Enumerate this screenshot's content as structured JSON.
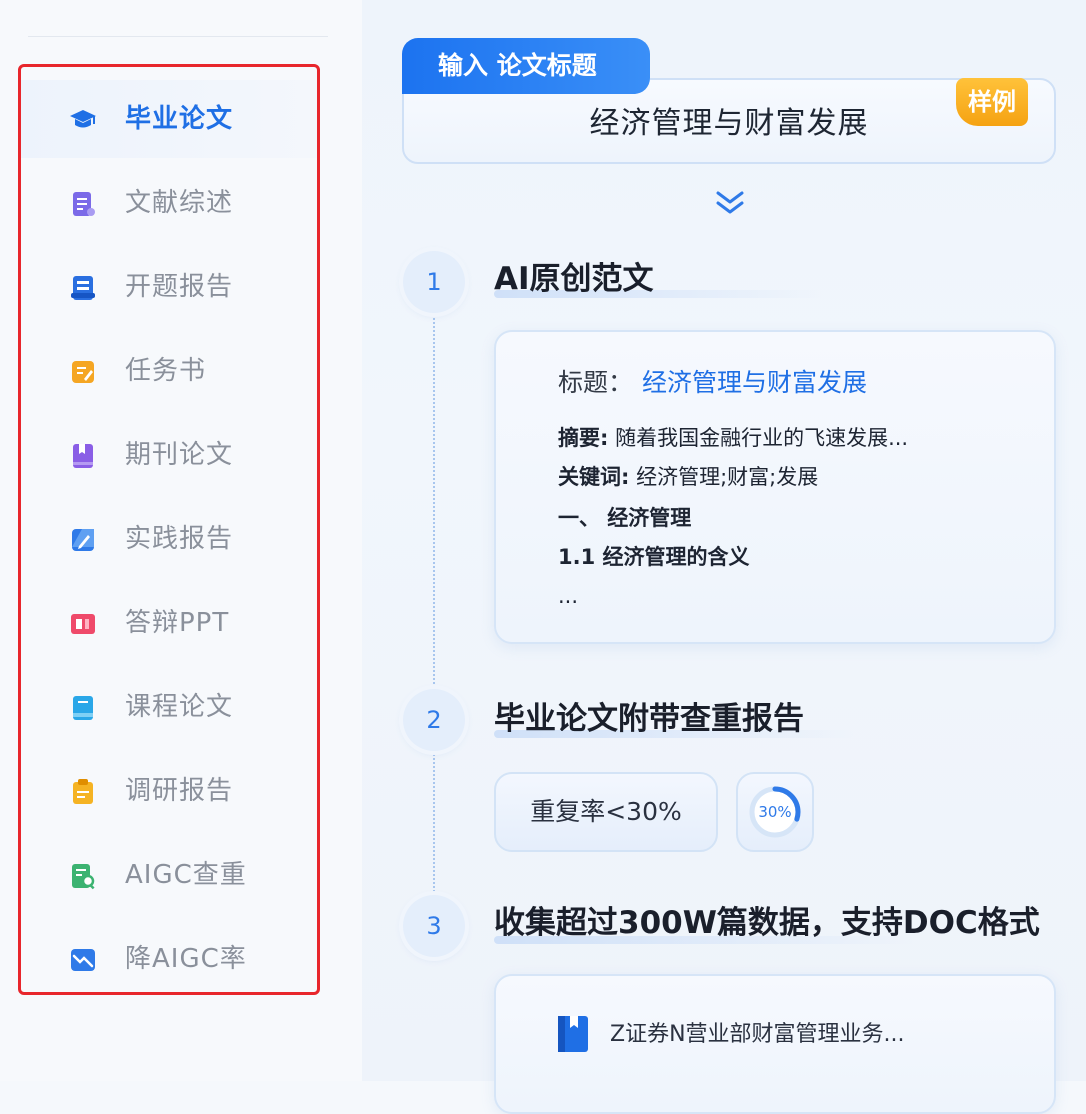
{
  "sidebar": {
    "items": [
      {
        "label": "毕业论文",
        "icon": "graduation-cap-icon",
        "active": true,
        "color": "#1f6fe5"
      },
      {
        "label": "文献综述",
        "icon": "document-list-icon",
        "active": false,
        "color": "#7b6ae8"
      },
      {
        "label": "开题报告",
        "icon": "report-stack-icon",
        "active": false,
        "color": "#2a6fe0"
      },
      {
        "label": "任务书",
        "icon": "task-edit-icon",
        "active": false,
        "color": "#f5a623"
      },
      {
        "label": "期刊论文",
        "icon": "journal-book-icon",
        "active": false,
        "color": "#8a5ee6"
      },
      {
        "label": "实践报告",
        "icon": "practice-edit-icon",
        "active": false,
        "color": "#2f7ae8"
      },
      {
        "label": "答辩PPT",
        "icon": "ppt-icon",
        "active": false,
        "color": "#ef4a6a"
      },
      {
        "label": "课程论文",
        "icon": "course-book-icon",
        "active": false,
        "color": "#2aa7e8"
      },
      {
        "label": "调研报告",
        "icon": "clipboard-icon",
        "active": false,
        "color": "#f5b323"
      },
      {
        "label": "AIGC查重",
        "icon": "search-doc-icon",
        "active": false,
        "color": "#3cb371"
      },
      {
        "label": "降AIGC率",
        "icon": "trend-down-icon",
        "active": false,
        "color": "#2f7ae8"
      }
    ]
  },
  "input": {
    "tab_label": "输入 论文标题",
    "title": "经济管理与财富发展",
    "sample_badge": "样例"
  },
  "steps": [
    {
      "number": "1",
      "heading": "AI原创范文"
    },
    {
      "number": "2",
      "heading": "毕业论文附带查重报告"
    },
    {
      "number": "3",
      "heading": "收集超过300W篇数据，支持DOC格式"
    }
  ],
  "card1": {
    "title_label": "标题：",
    "title_value": "经济管理与财富发展",
    "abstract_label": "摘要:",
    "abstract_text": " 随着我国金融行业的飞速发展...",
    "keywords_label": "关键词:",
    "keywords_text": " 经济管理;财富;发展",
    "section_1": "一、 经济管理",
    "section_1_1": "1.1 经济管理的含义",
    "ellipsis": "..."
  },
  "check": {
    "rate_label": "重复率<30%",
    "ring_label": "30%",
    "ring_fraction": 0.3
  },
  "card3": {
    "doc_title": "Z证券N营业部财富管理业务..."
  },
  "colors": {
    "accent": "#1f6fe5",
    "highlight_frame": "#e8262c",
    "badge": "#f5a212"
  }
}
